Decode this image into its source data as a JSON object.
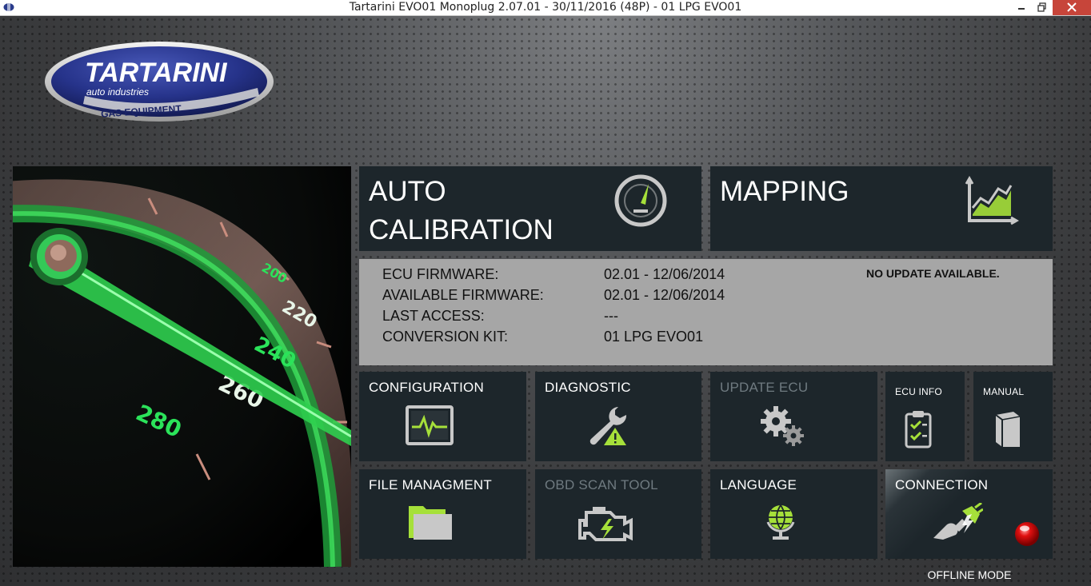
{
  "window": {
    "title": "Tartarini EVO01 Monoplug 2.07.01 - 30/11/2016 (48P) - 01 LPG EVO01"
  },
  "logo": {
    "brand": "TARTARINI",
    "line1": "auto industries",
    "line2": "GAS EQUIPMENT"
  },
  "speedometer": {
    "ticks": [
      "200",
      "220",
      "240",
      "260",
      "280"
    ]
  },
  "tiles": {
    "auto_calibration": {
      "line1": "AUTO",
      "line2": "CALIBRATION"
    },
    "mapping": {
      "label": "MAPPING"
    },
    "configuration": {
      "label": "CONFIGURATION"
    },
    "diagnostic": {
      "label": "DIAGNOSTIC"
    },
    "update_ecu": {
      "label": "UPDATE ECU"
    },
    "ecu_info": {
      "label": "ECU INFO"
    },
    "manual": {
      "label": "MANUAL"
    },
    "file_management": {
      "label": "FILE MANAGMENT"
    },
    "obd_scan_tool": {
      "label": "OBD SCAN TOOL"
    },
    "language": {
      "label": "LANGUAGE"
    },
    "connection": {
      "label": "CONNECTION"
    }
  },
  "info": {
    "rows": [
      {
        "label": "ECU FIRMWARE:",
        "value": "02.01 - 12/06/2014"
      },
      {
        "label": "AVAILABLE FIRMWARE:",
        "value": "02.01 - 12/06/2014"
      },
      {
        "label": "LAST ACCESS:",
        "value": "---"
      },
      {
        "label": "CONVERSION KIT:",
        "value": "01 LPG EVO01"
      }
    ],
    "notice": "NO UPDATE AVAILABLE."
  },
  "status": {
    "mode": "OFFLINE MODE"
  },
  "colors": {
    "accent_green": "#a6e03a",
    "tile_bg": "#1d262b",
    "status_led": "#e01010"
  },
  "icons": {
    "auto_calibration": "speedometer-icon",
    "mapping": "line-chart-icon",
    "configuration": "monitor-pulse-icon",
    "diagnostic": "wrench-warning-icon",
    "update_ecu": "gears-icon",
    "ecu_info": "clipboard-check-icon",
    "manual": "book-icon",
    "file_management": "folder-icon",
    "obd_scan_tool": "engine-icon",
    "language": "globe-icon",
    "connection": "plug-icon"
  }
}
